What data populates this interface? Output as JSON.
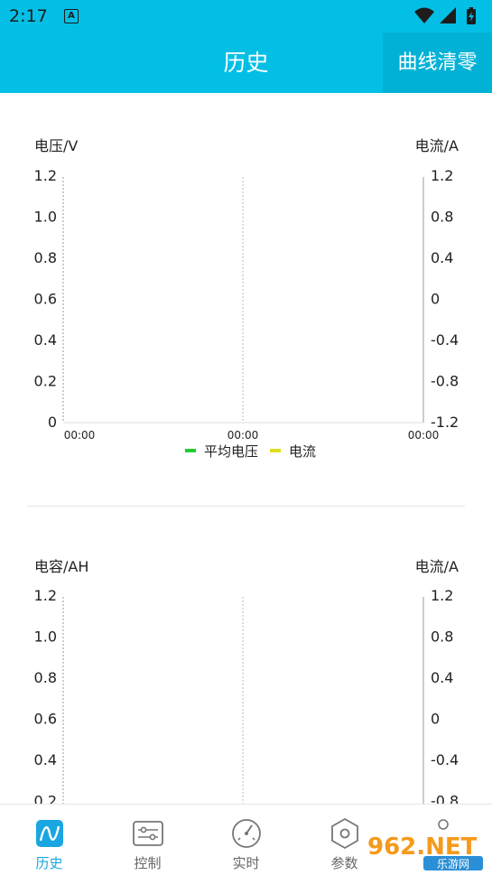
{
  "status_bar": {
    "time": "2:17",
    "app_icon_letter": "A"
  },
  "app_bar": {
    "title": "历史",
    "clear_label": "曲线清零"
  },
  "legend": {
    "avg_voltage": {
      "label": "平均电压",
      "color": "#22cc33"
    },
    "current": {
      "label": "电流",
      "color": "#dddd22"
    }
  },
  "chart_data": [
    {
      "type": "line",
      "ylabel_left": "电压/V",
      "ylabel_right": "电流/A",
      "left_ticks": [
        "1.2",
        "1.0",
        "0.8",
        "0.6",
        "0.4",
        "0.2",
        "0"
      ],
      "right_ticks": [
        "1.2",
        "0.8",
        "0.4",
        "0",
        "-0.4",
        "-0.8",
        "-1.2"
      ],
      "ylim_left": [
        0,
        1.2
      ],
      "ylim_right": [
        -1.2,
        1.2
      ],
      "x_ticks": [
        "00:00",
        "00:00",
        "00:00"
      ],
      "series": [
        {
          "name": "平均电压",
          "values": []
        },
        {
          "name": "电流",
          "values": []
        }
      ],
      "grid": "vertical-dashed",
      "legend_position": "bottom-center"
    },
    {
      "type": "line",
      "ylabel_left": "电容/AH",
      "ylabel_right": "电流/A",
      "left_ticks": [
        "1.2",
        "1.0",
        "0.8",
        "0.6",
        "0.4",
        "0.2"
      ],
      "right_ticks": [
        "1.2",
        "0.8",
        "0.4",
        "0",
        "-0.4",
        "-0.8"
      ],
      "ylim_left": [
        0,
        1.2
      ],
      "ylim_right": [
        -1.2,
        1.2
      ],
      "x_ticks": [],
      "series": [],
      "grid": "vertical-dashed"
    }
  ],
  "bottom_nav": {
    "items": [
      {
        "label": "历史",
        "icon": "history-curve-icon",
        "active": true
      },
      {
        "label": "控制",
        "icon": "sliders-icon",
        "active": false
      },
      {
        "label": "实时",
        "icon": "gauge-icon",
        "active": false
      },
      {
        "label": "参数",
        "icon": "hexagon-nut-icon",
        "active": false
      }
    ]
  },
  "watermark": {
    "brand": "962.NET",
    "sub": "乐游网"
  },
  "colors": {
    "primary": "#03bfe6",
    "active_nav": "#1aa6e0",
    "axis": "#999999",
    "grid": "#bbbbbb"
  }
}
